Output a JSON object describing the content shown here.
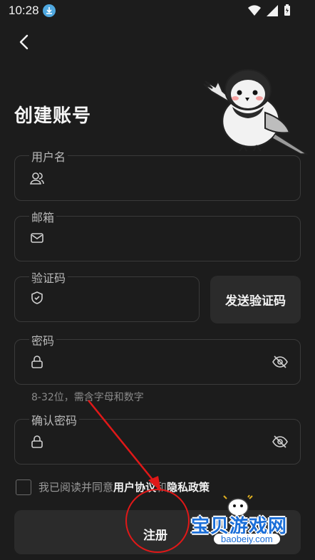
{
  "status_bar": {
    "time": "10:28"
  },
  "page": {
    "title": "创建账号"
  },
  "fields": {
    "username": {
      "label": "用户名",
      "icon": "user-icon"
    },
    "email": {
      "label": "邮箱",
      "icon": "mail-icon"
    },
    "code": {
      "label": "验证码",
      "icon": "shield-icon"
    },
    "password": {
      "label": "密码",
      "icon": "lock-icon",
      "hint": "8-32位，需含字母和数字"
    },
    "confirm": {
      "label": "确认密码",
      "icon": "lock-icon"
    }
  },
  "send_code_label": "发送验证码",
  "agreement": {
    "prefix": "我已阅读并同意",
    "terms": "用户协议",
    "and": "和",
    "privacy": "隐私政策"
  },
  "register_label": "注册",
  "watermark": {
    "text": "宝贝游戏网",
    "url": "baobeiy.com"
  },
  "colors": {
    "background": "#1c1c1c",
    "annotation": "#e01818",
    "watermark": "#1a6ed8"
  }
}
